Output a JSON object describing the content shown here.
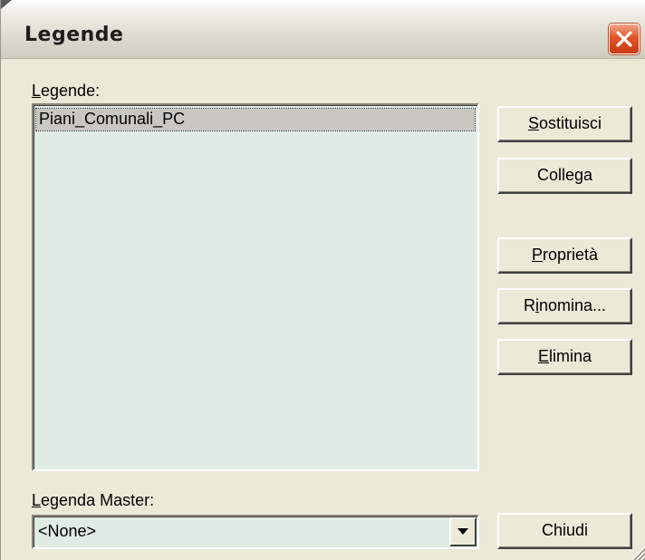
{
  "window": {
    "title": "Legende",
    "close_icon": "close-icon",
    "close_color": "#e2542a"
  },
  "legends_section": {
    "label": "Legende:",
    "label_accel": "L",
    "label_rest": "egende:",
    "items": [
      {
        "label": "Piani_Comunali_PC",
        "selected": true
      }
    ],
    "background": "#e0ebe4"
  },
  "buttons": {
    "replace": {
      "label": "Sostituisci",
      "pre": "",
      "accel": "S",
      "post": "ostituisci"
    },
    "link": {
      "label": "Collega",
      "pre": "Colle",
      "accel": "g",
      "post": "a"
    },
    "properties": {
      "label": "Proprietà",
      "pre": "",
      "accel": "P",
      "post": "roprietà"
    },
    "rename": {
      "label": "Rinomina...",
      "pre": "R",
      "accel": "i",
      "post": "nomina..."
    },
    "delete": {
      "label": "Elimina",
      "pre": "",
      "accel": "E",
      "post": "limina"
    },
    "close": {
      "label": "Chiudi"
    }
  },
  "master": {
    "label": "Legenda Master:",
    "label_accel": "L",
    "label_rest": "egenda Master:",
    "selected_value": "<None>",
    "dropdown_icon": "chevron-down-icon"
  }
}
